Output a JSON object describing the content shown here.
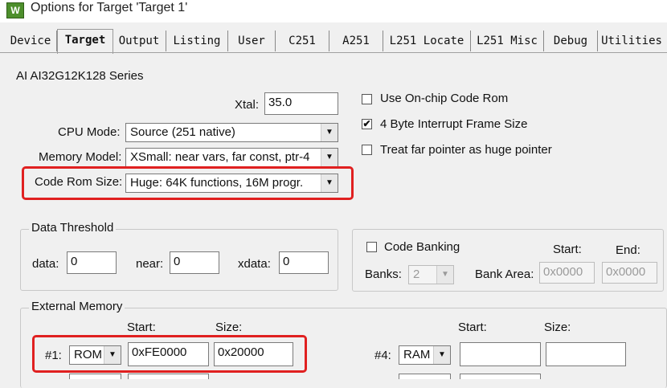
{
  "window": {
    "title": "Options for Target 'Target 1'",
    "icon_text": "W"
  },
  "tabs": [
    {
      "label": "Device"
    },
    {
      "label": "Target"
    },
    {
      "label": "Output"
    },
    {
      "label": "Listing"
    },
    {
      "label": "User"
    },
    {
      "label": "C251"
    },
    {
      "label": "A251"
    },
    {
      "label": "L251 Locate"
    },
    {
      "label": "L251 Misc"
    },
    {
      "label": "Debug"
    },
    {
      "label": "Utilities"
    }
  ],
  "device_series": "AI AI32G12K128 Series",
  "xtal": {
    "label": "Xtal:",
    "value": "35.0"
  },
  "cpu_mode": {
    "label": "CPU Mode:",
    "value": "Source (251 native)"
  },
  "memory_model": {
    "label": "Memory Model:",
    "value": "XSmall: near vars, far const, ptr-4"
  },
  "code_rom_size": {
    "label": "Code Rom Size:",
    "value": "Huge: 64K functions, 16M progr."
  },
  "options": {
    "onchip": {
      "label": "Use On-chip Code Rom",
      "checked": false
    },
    "interrupt": {
      "label": "4 Byte Interrupt Frame Size",
      "checked": true,
      "mark": "✔"
    },
    "far_pointer": {
      "label": "Treat far pointer as huge pointer",
      "checked": false
    }
  },
  "data_threshold": {
    "title": "Data Threshold",
    "data": {
      "label": "data:",
      "value": "0"
    },
    "near": {
      "label": "near:",
      "value": "0"
    },
    "xdata": {
      "label": "xdata:",
      "value": "0"
    }
  },
  "code_banking": {
    "label": "Code Banking",
    "checked": false,
    "start_label": "Start:",
    "end_label": "End:",
    "banks_label": "Banks:",
    "banks_value": "2",
    "bank_area_label": "Bank Area:",
    "start_value": "0x0000",
    "end_value": "0x0000"
  },
  "external_memory": {
    "title": "External Memory",
    "start_label": "Start:",
    "size_label": "Size:",
    "row1": {
      "label": "#1:",
      "type": "ROM",
      "start": "0xFE0000",
      "size": "0x20000"
    },
    "row4": {
      "label": "#4:",
      "type": "RAM",
      "start": "",
      "size": ""
    }
  }
}
